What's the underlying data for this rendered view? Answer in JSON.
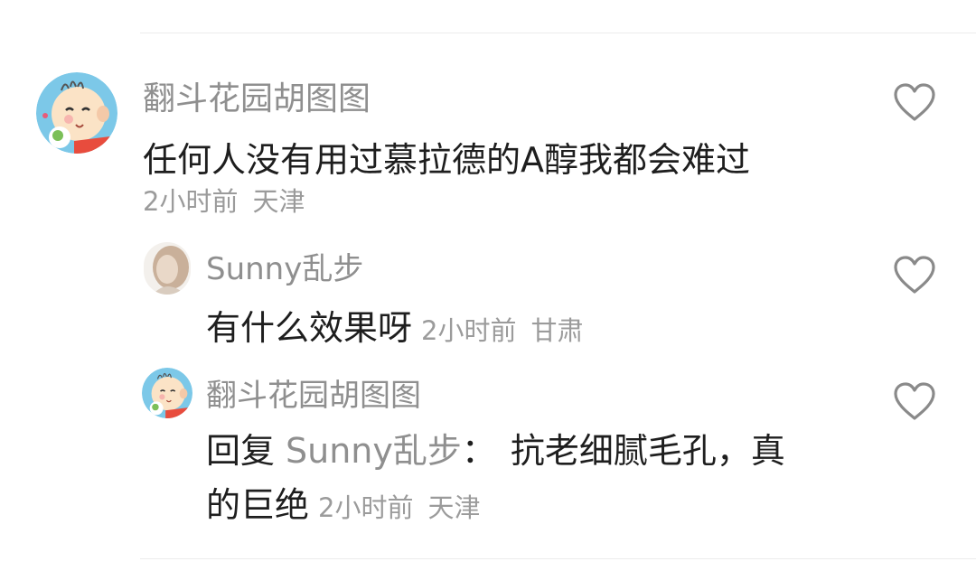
{
  "comment": {
    "username": "翻斗花园胡图图",
    "text": "任何人没有用过慕拉德的A醇我都会难过",
    "time": "2小时前",
    "location": "天津",
    "avatar_icon": "cartoon-boy-avatar",
    "like_icon": "heart-outline-icon"
  },
  "replies": [
    {
      "username": "Sunny乱步",
      "text": "有什么效果呀",
      "time": "2小时前",
      "location": "甘肃",
      "avatar_icon": "photo-avatar",
      "like_icon": "heart-outline-icon"
    },
    {
      "username": "翻斗花园胡图图",
      "reply_prefix": "回复",
      "reply_target": "Sunny乱步",
      "reply_colon": "：",
      "text_line1": "抗老细腻毛孔，真",
      "text_line2": "的巨绝",
      "time": "2小时前",
      "location": "天津",
      "avatar_icon": "cartoon-boy-avatar",
      "like_icon": "heart-outline-icon"
    }
  ],
  "colors": {
    "username": "#8f8f8f",
    "text": "#1e1e1e",
    "meta": "#9b9b9b",
    "icon": "#8a8a8a"
  }
}
